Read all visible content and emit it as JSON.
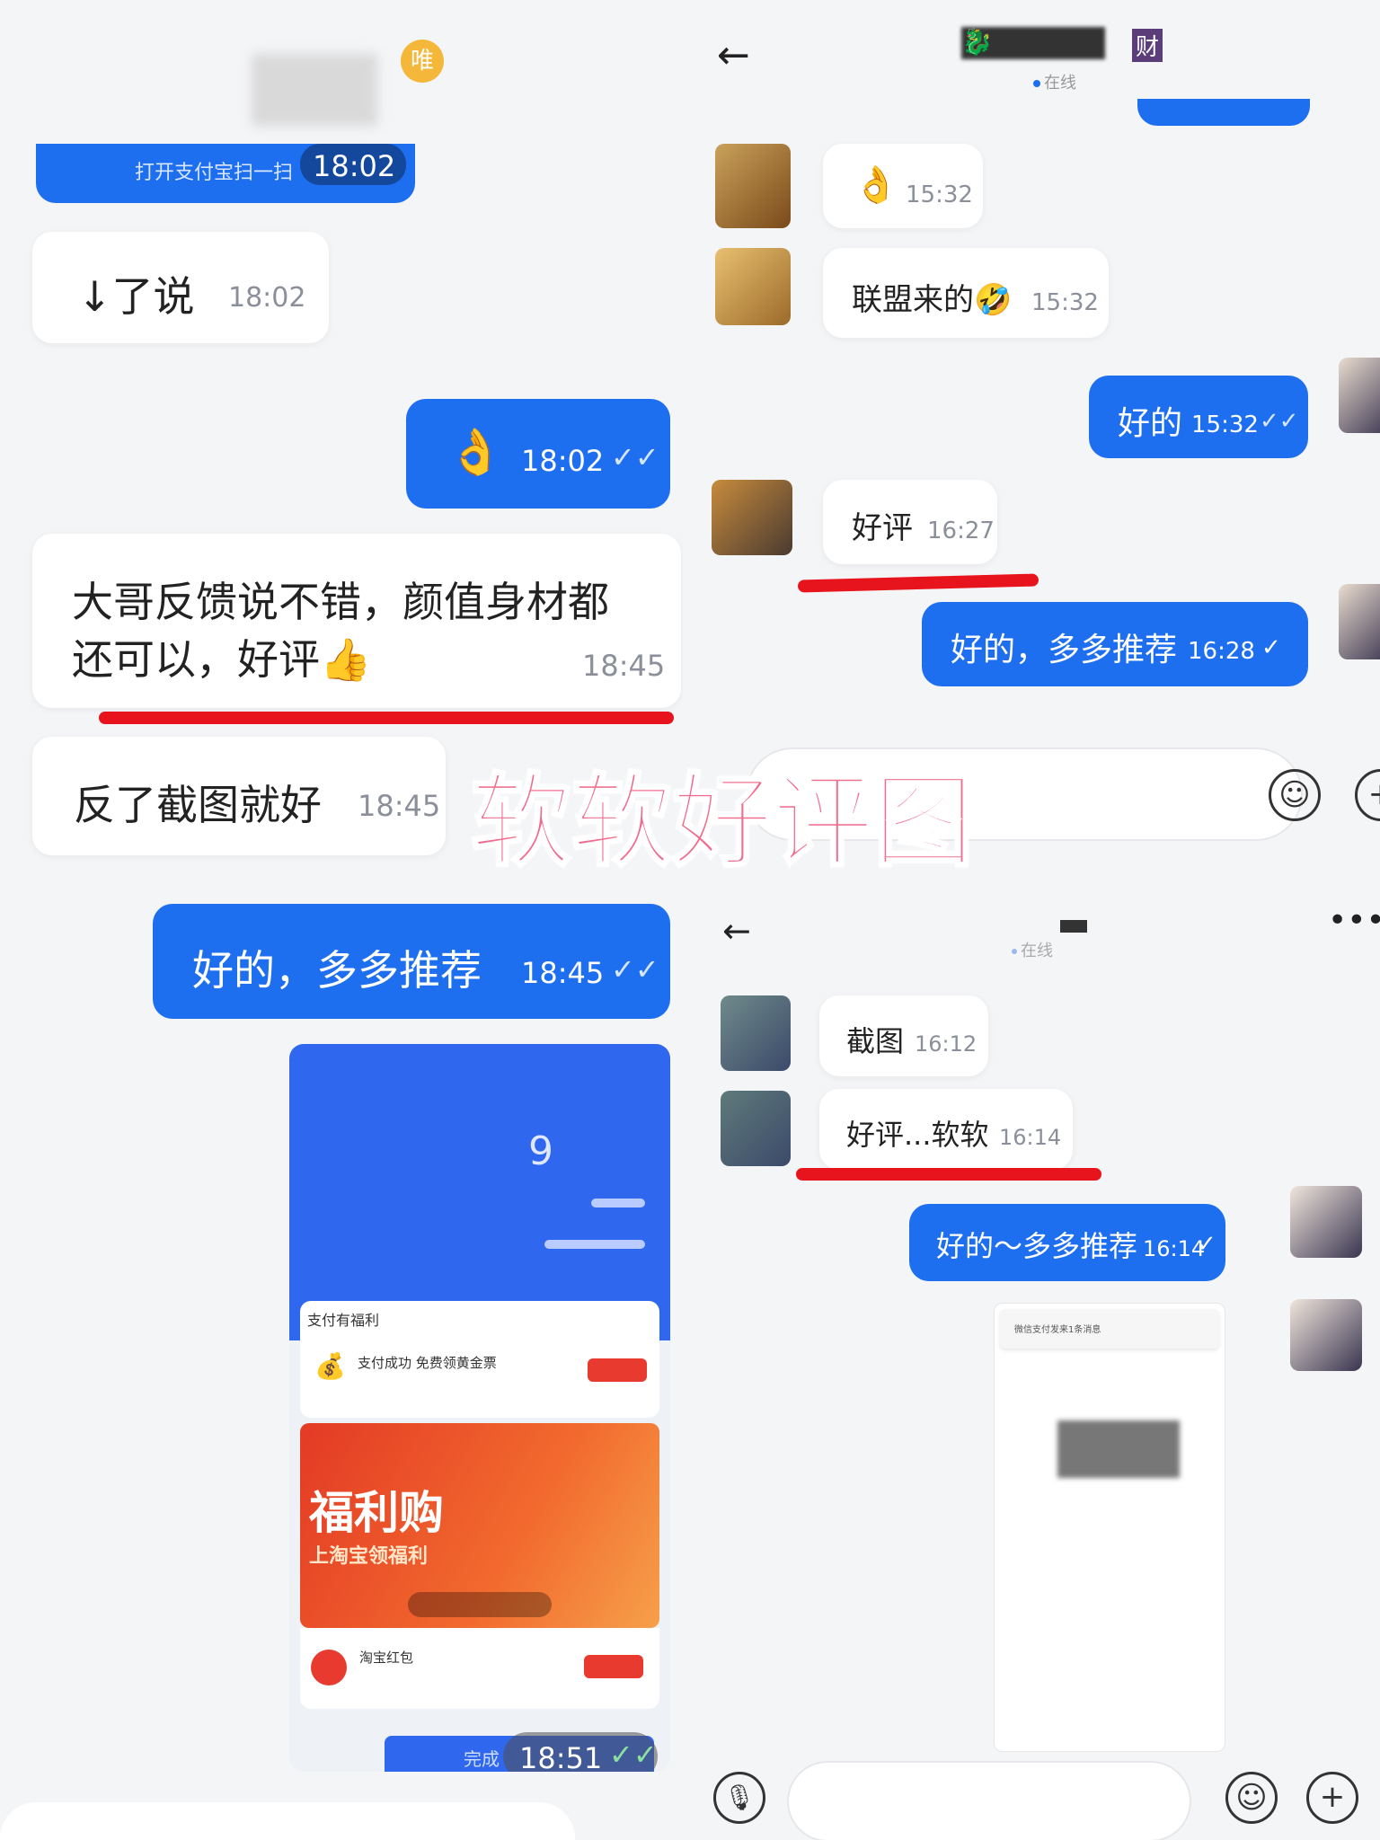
{
  "left": {
    "header_badge": "唯",
    "first_message": {
      "text": "打开支付宝扫一扫",
      "time": "18:02"
    },
    "messages": [
      {
        "text": "↓了说",
        "time": "18:02"
      },
      {
        "time": "18:02"
      },
      {
        "line1": "大哥反馈说不错，颜值身材都",
        "line2": "还可以，好评👍",
        "time": "18:45"
      },
      {
        "text": "反了截图就好",
        "time": "18:45"
      },
      {
        "text": "好的，多多推荐",
        "time": "18:45"
      }
    ],
    "screenshot": {
      "digit": "9",
      "section_label": "支付有福利",
      "row1_title": "支付成功 免费领黄金票",
      "promo_title": "福利购",
      "promo_subtitle": "上淘宝领福利",
      "row2_title": "淘宝红包",
      "done_label": "完成",
      "time": "18:51"
    }
  },
  "right_top": {
    "header_tag": "财",
    "status": "在线",
    "messages": [
      {
        "time": "15:32"
      },
      {
        "text": "联盟来的🤣",
        "time": "15:32"
      },
      {
        "text": "好的",
        "time": "15:32"
      },
      {
        "text": "好评",
        "time": "16:27"
      },
      {
        "text": "好的，多多推荐",
        "time": "16:28"
      }
    ]
  },
  "right_bottom": {
    "status": "在线",
    "messages": [
      {
        "text": "截图",
        "time": "16:12"
      },
      {
        "text": "好评...软软",
        "time": "16:14"
      },
      {
        "text": "好的～多多推荐",
        "time": "16:14"
      }
    ],
    "card_title": "微信支付发来1条消息"
  },
  "overlay_title": "软软好评图",
  "colors": {
    "accent": "#1e6ff0",
    "underline": "#e8141d",
    "overlay": "#f06c8e"
  }
}
